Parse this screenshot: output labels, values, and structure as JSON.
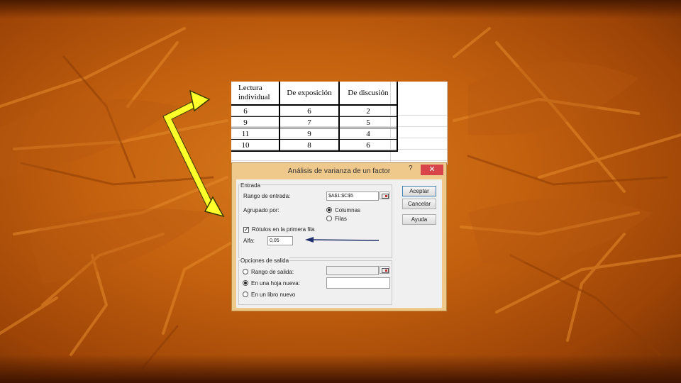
{
  "sheet": {
    "headers": [
      "Lectura individual",
      "De exposición",
      "De discusión"
    ],
    "header_first_lines": [
      "Lectura",
      "individual"
    ],
    "rows": [
      [
        "6",
        "6",
        "2"
      ],
      [
        "9",
        "7",
        "5"
      ],
      [
        "11",
        "9",
        "4"
      ],
      [
        "10",
        "8",
        "6"
      ]
    ]
  },
  "dialog": {
    "title": "Análisis de varianza de un factor",
    "help_label": "?",
    "close_label": "✕",
    "input_group_label": "Entrada",
    "input_range_label": "Rango de entrada:",
    "input_range_value": "$A$1:$C$5",
    "grouped_by_label": "Agrupado por:",
    "columns_label": "Columnas",
    "rows_label": "Filas",
    "grouped_by_selected": "Columnas",
    "labels_first_row_label": "Rótulos en la primera fila",
    "labels_first_row_checked": true,
    "alpha_label": "Alfa:",
    "alpha_value": "0,05",
    "output_group_label": "Opciones de salida",
    "output_range_label": "Rango de salida:",
    "new_sheet_label": "En una hoja nueva:",
    "new_book_label": "En un libro nuevo",
    "output_selected": "En una hoja nueva:",
    "ok_label": "Aceptar",
    "cancel_label": "Cancelar",
    "help_button_label": "Ayuda"
  },
  "annotations": {
    "double_arrow_color": "#ffff00",
    "pointer_arrow_color": "#1f2f6b"
  },
  "icons": [
    "range-picker-icon",
    "close-icon",
    "help-icon"
  ]
}
